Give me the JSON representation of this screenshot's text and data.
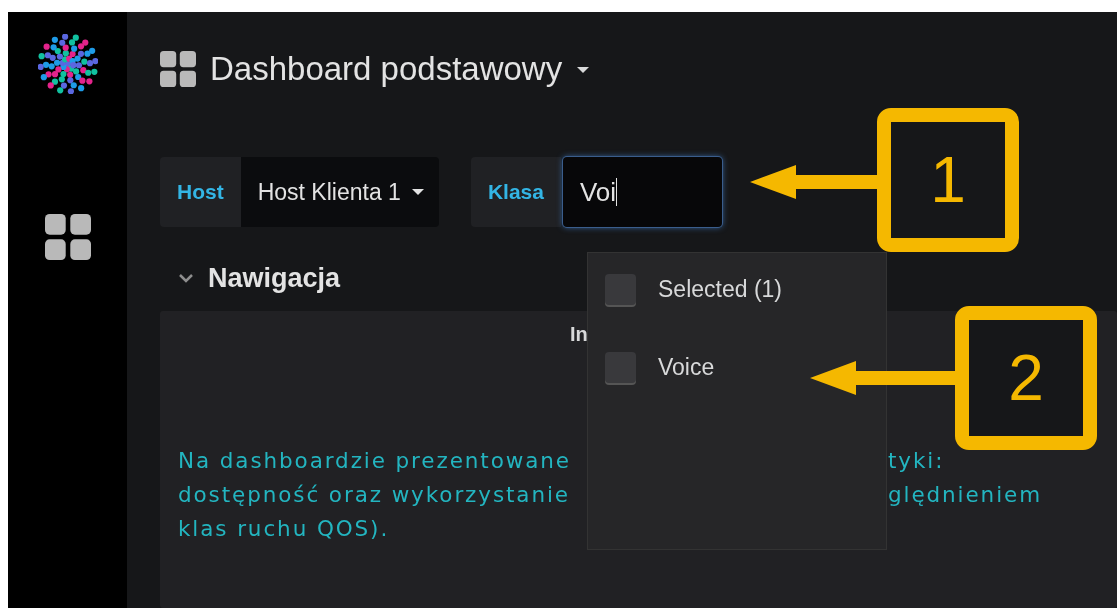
{
  "header": {
    "title": "Dashboard podstawowy"
  },
  "variables": [
    {
      "kind": "select",
      "label": "Host",
      "value": "Host Klienta 1",
      "focused": false
    },
    {
      "kind": "input",
      "label": "Klasa",
      "value": "Voi",
      "focused": true
    }
  ],
  "row": {
    "title": "Nawigacja",
    "expanded": true
  },
  "panel": {
    "title": "In",
    "lines": [
      {
        "left": "Na dashboardzie prezentowane",
        "right": "tyki:"
      },
      {
        "left": "dostępność oraz wykorzystanie",
        "right": "ględnieniem"
      },
      {
        "left": "klas ruchu QOS)."
      }
    ]
  },
  "dropdown": {
    "options": [
      {
        "label": "Selected (1)",
        "checked": false
      },
      {
        "label": "Voice",
        "checked": false
      }
    ]
  },
  "annotations": [
    {
      "label": "1"
    },
    {
      "label": "2"
    }
  ]
}
